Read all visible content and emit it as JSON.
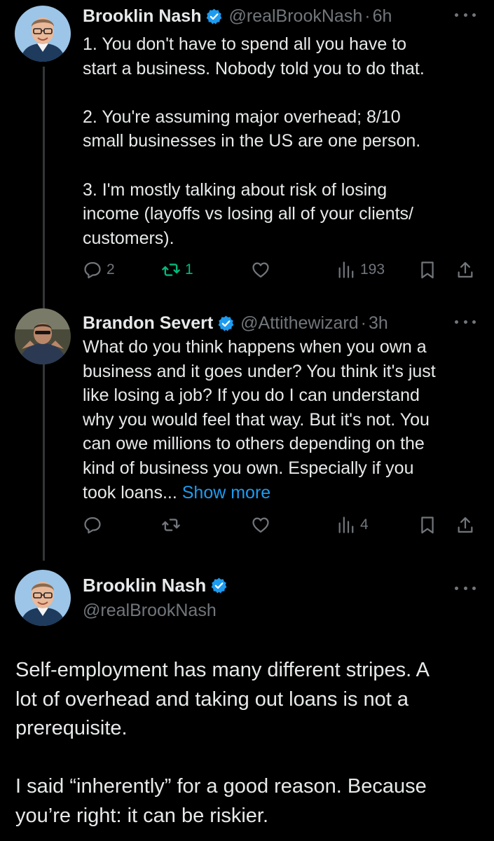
{
  "colors": {
    "background": "#000000",
    "text": "#e7e9ea",
    "muted": "#71767b",
    "accent": "#1d9bf0",
    "retweet_active": "#00ba7c",
    "thread_line": "#333639"
  },
  "tweets": [
    {
      "name": "Brooklin Nash",
      "handle": "@realBrookNash",
      "separator": "·",
      "time": "6h",
      "verified_icon": "verified-badge-icon",
      "text": "1. You don't have to spend all you have to\nstart a business. Nobody told you to do that.\n\n2. You're assuming major overhead; 8/10\nsmall businesses in the US are one person.\n\n3. I'm mostly talking about risk of losing\nincome (layoffs vs losing all of your clients/\ncustomers).",
      "replies": "2",
      "retweets": "1",
      "views": "193"
    },
    {
      "name": "Brandon Severt",
      "handle": "@Attithewizard",
      "separator": "·",
      "time": "3h",
      "verified_icon": "verified-badge-icon",
      "text": "What do you think happens when you own a\nbusiness and it goes under? You think it's just\nlike losing a job? If you do I can understand\nwhy you would feel that way. But it's not. You\ncan owe millions to others depending on the\nkind of business you own. Especially if you\ntook loans... ",
      "show_more": "Show more",
      "views": "4"
    }
  ],
  "main_tweet": {
    "name": "Brooklin Nash",
    "handle": "@realBrookNash",
    "verified_icon": "verified-badge-icon",
    "text": "Self-employment has many different stripes. A\nlot of overhead and taking out loans is not a\nprerequisite.\n\nI said “inherently” for a good reason. Because\nyou’re right: it can be riskier."
  },
  "icons": [
    "reply-icon",
    "retweet-icon",
    "like-icon",
    "views-icon",
    "bookmark-icon",
    "share-icon",
    "more-icon"
  ]
}
